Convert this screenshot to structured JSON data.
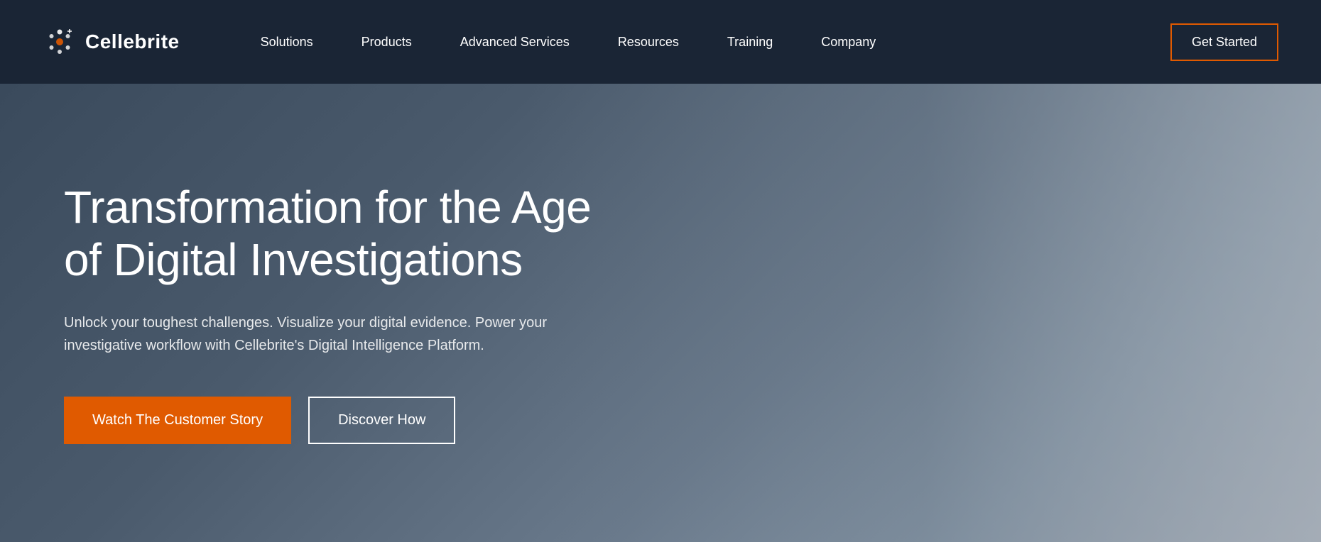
{
  "brand": {
    "name": "Cellebrite",
    "logo_alt": "Cellebrite logo"
  },
  "navbar": {
    "links": [
      {
        "label": "Solutions",
        "id": "nav-solutions"
      },
      {
        "label": "Products",
        "id": "nav-products"
      },
      {
        "label": "Advanced Services",
        "id": "nav-advanced-services"
      },
      {
        "label": "Resources",
        "id": "nav-resources"
      },
      {
        "label": "Training",
        "id": "nav-training"
      },
      {
        "label": "Company",
        "id": "nav-company"
      }
    ],
    "cta_label": "Get Started"
  },
  "hero": {
    "title": "Transformation for the Age of Digital Investigations",
    "subtitle": "Unlock your toughest challenges. Visualize your digital evidence. Power your investigative workflow with Cellebrite's Digital Intelligence Platform.",
    "btn_primary": "Watch The Customer Story",
    "btn_secondary": "Discover How"
  }
}
